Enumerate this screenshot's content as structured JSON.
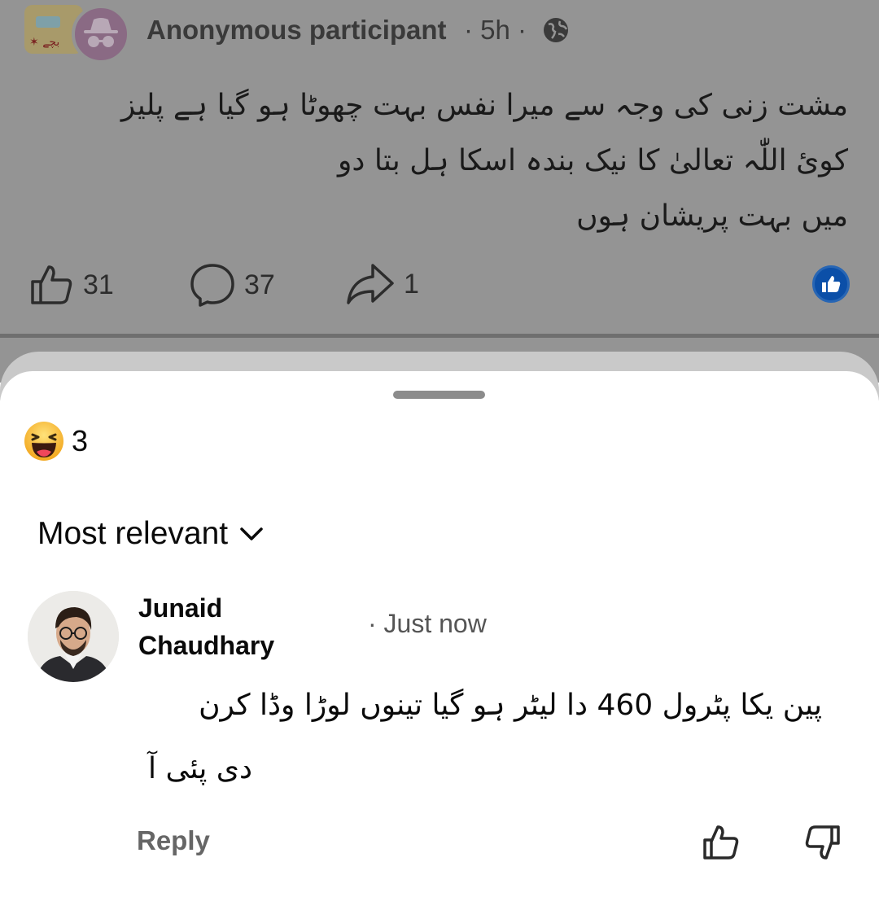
{
  "post": {
    "author": "Anonymous participant",
    "meta": "· 5h ·",
    "text_lines": [
      "مشت زنی کی وجہ سے میرا نفس بہت چھوٹا ہو گیا ہے پلیز",
      "کوئ اللّٰہ تعالیٰ کا نیک بندہ اسکا ہل بتا دو",
      "میں بہت پریشان ہوں"
    ],
    "likes": "31",
    "comments": "37",
    "shares": "1",
    "group_thumb_text": "✶ بچے"
  },
  "sheet": {
    "reaction_emoji": "😄",
    "reaction_count": "3",
    "sort_label": "Most relevant"
  },
  "comment": {
    "author_line1": "Junaid",
    "author_line2": "Chaudhary",
    "time": "· Just now",
    "text_line1": "پین یکا پٹرول 460 دا لیٹر ہو گیا تینوں لوڑا وڈا کرن",
    "text_line2": "دی پئی آ",
    "reply_label": "Reply"
  },
  "colors": {
    "overlay": "#949494",
    "like_blue": "#0b4fa8",
    "anon_avatar": "#8a6a84"
  },
  "icons": [
    "globe-icon",
    "like-icon",
    "comment-icon",
    "share-icon",
    "chevron-down-icon",
    "thumbs-up-icon",
    "thumbs-down-icon"
  ]
}
